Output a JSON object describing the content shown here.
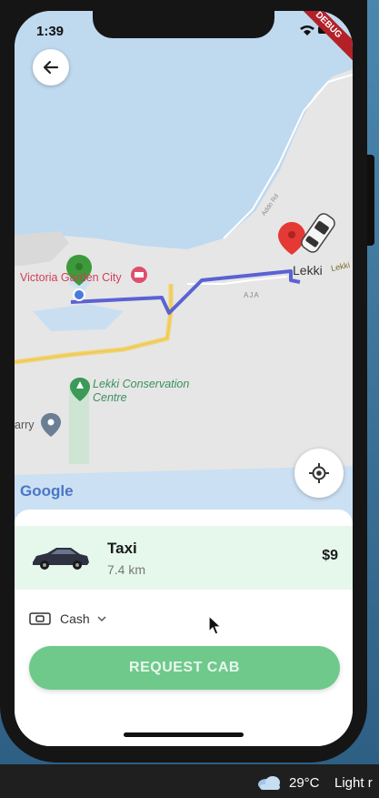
{
  "status": {
    "time": "1:39",
    "debug_badge": "DEBUG"
  },
  "map": {
    "places": {
      "victoria": "Victoria Garden City",
      "lekki": "Lekki",
      "lekki_road": "Lekki",
      "aja": "AJA",
      "conservation": "Lekki Conservation Centre",
      "arry": "arry",
      "road": "Addo Rd"
    },
    "attribution": "Google"
  },
  "ride": {
    "name": "Taxi",
    "distance": "7.4 km",
    "price": "$9"
  },
  "payment": {
    "method": "Cash"
  },
  "request_label": "REQUEST CAB",
  "taskbar": {
    "temperature": "29°C",
    "condition": "Light r"
  },
  "colors": {
    "accent": "#6fc98b",
    "route": "#5a62d4",
    "selected_bg": "#e6f7ec"
  }
}
